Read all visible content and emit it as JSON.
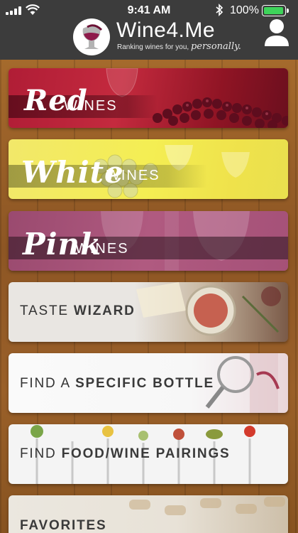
{
  "status_bar": {
    "time": "9:41 AM",
    "battery_percent": "100%",
    "battery_level": 1.0
  },
  "header": {
    "brand": "Wine4.Me",
    "tagline_prefix": "Ranking wines for you,",
    "tagline_script": "personally."
  },
  "menu": {
    "red": {
      "script": "Red",
      "label": "WINES"
    },
    "white": {
      "script": "White",
      "label": "WINES"
    },
    "pink": {
      "script": "Pink",
      "label": "WINES"
    },
    "taste": {
      "light": "TASTE ",
      "bold": "WIZARD"
    },
    "bottle": {
      "light": "FIND A ",
      "bold": "SPECIFIC BOTTLE"
    },
    "pairings": {
      "light": "FIND ",
      "bold": "FOOD/WINE PAIRINGS"
    },
    "favorites": {
      "light": "",
      "bold": "FAVORITES"
    }
  },
  "colors": {
    "header_bg": "#3c3c3c",
    "red_card": "#b01d36",
    "white_card": "#f2e86a",
    "pink_card": "#a55178",
    "battery_green": "#3ed35a"
  },
  "icons": [
    "signal-icon",
    "wifi-icon",
    "bluetooth-icon",
    "battery-icon",
    "wine-logo-icon",
    "profile-icon"
  ]
}
